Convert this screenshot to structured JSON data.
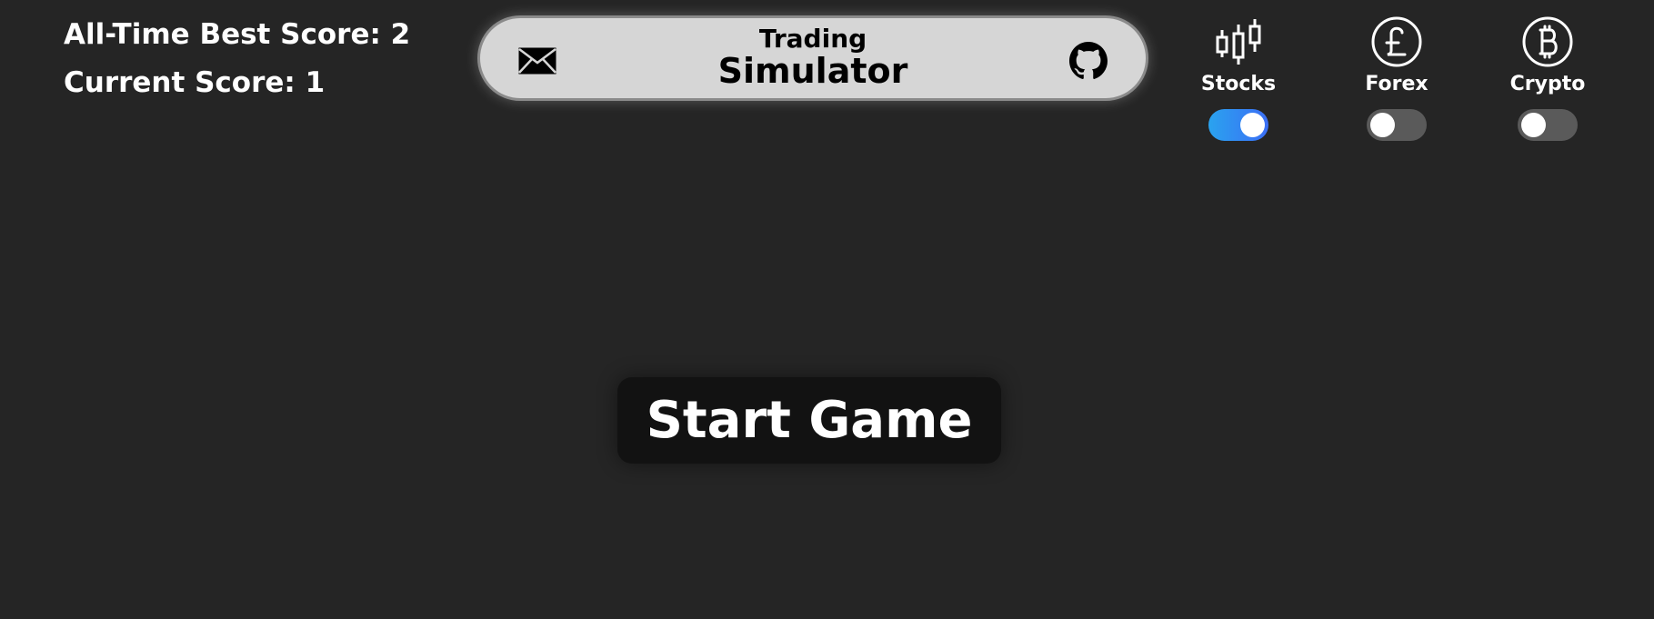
{
  "scores": {
    "best_label": "All-Time Best Score: 2",
    "current_label": "Current Score: 1"
  },
  "title": {
    "line1": "Trading",
    "line2": "Simulator",
    "left_icon": "mail-icon",
    "right_icon": "github-icon"
  },
  "markets": [
    {
      "label": "Stocks",
      "icon": "candlestick-icon",
      "enabled": true
    },
    {
      "label": "Forex",
      "icon": "pound-icon",
      "enabled": false
    },
    {
      "label": "Crypto",
      "icon": "bitcoin-icon",
      "enabled": false
    }
  ],
  "start_button": {
    "label": "Start Game"
  },
  "colors": {
    "background": "#252525",
    "pill": "#d6d6d6",
    "toggle_on": "#3b6ef5",
    "toggle_off": "#5a5a5a",
    "button": "#121212"
  }
}
